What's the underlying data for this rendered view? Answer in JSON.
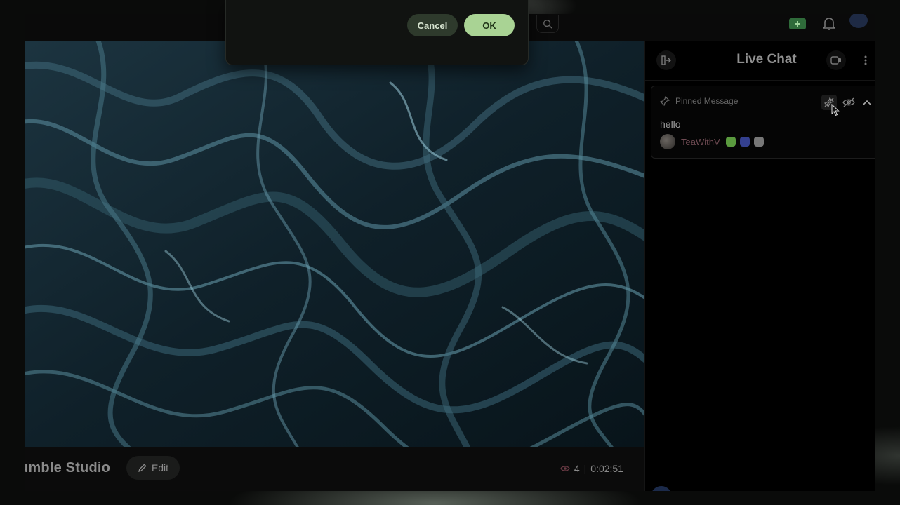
{
  "dialog": {
    "cancel_label": "Cancel",
    "ok_label": "OK",
    "accent": "#a9d394"
  },
  "header": {
    "icons": [
      "search-icon",
      "create-icon",
      "bell-icon",
      "avatar"
    ]
  },
  "stream": {
    "title": "umble Studio",
    "edit_label": "Edit",
    "viewers": "4",
    "duration": "0:02:51"
  },
  "chat": {
    "title": "Live Chat",
    "pinned": {
      "label": "Pinned Message",
      "text": "hello",
      "author": "TeaWithV",
      "badges": [
        "#6fb34a",
        "#3c4aa6",
        "#8c8c8c"
      ]
    }
  }
}
